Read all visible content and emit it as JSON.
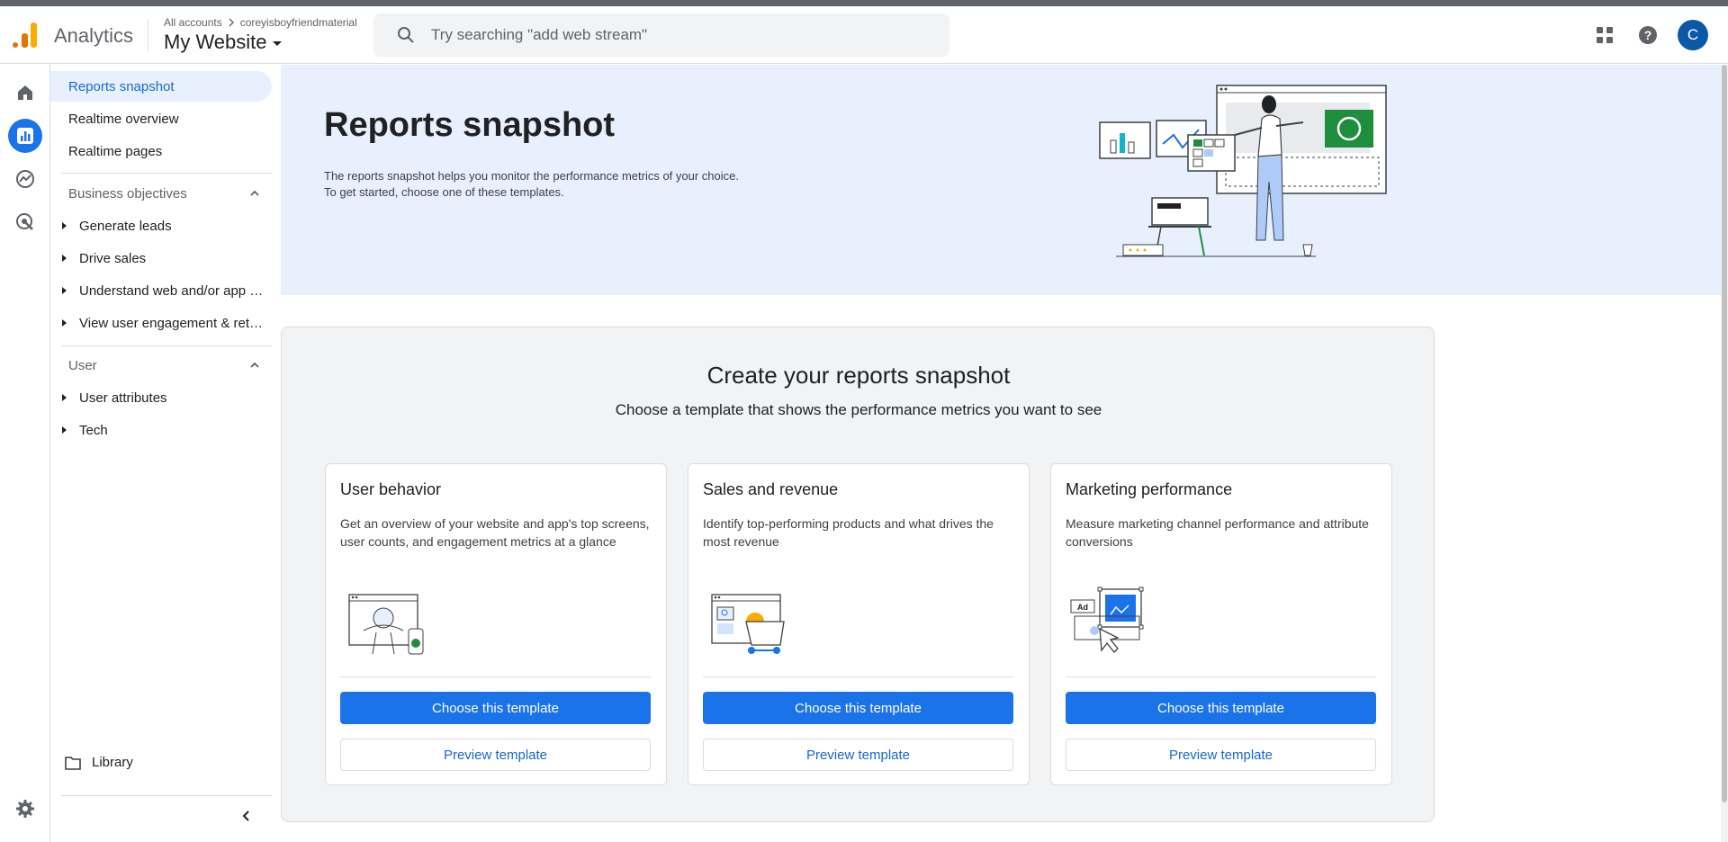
{
  "header": {
    "app_name": "Analytics",
    "breadcrumb_root": "All accounts",
    "breadcrumb_account": "coreyisboyfriendmaterial",
    "property": "My Website",
    "search_placeholder": "Try searching \"add web stream\"",
    "avatar_letter": "C"
  },
  "sidebar": {
    "top_items": [
      {
        "label": "Reports snapshot",
        "active": true
      },
      {
        "label": "Realtime overview"
      },
      {
        "label": "Realtime pages"
      }
    ],
    "groups": [
      {
        "label": "Business objectives",
        "items": [
          "Generate leads",
          "Drive sales",
          "Understand web and/or app traffic",
          "View user engagement & retention"
        ]
      },
      {
        "label": "User",
        "items": [
          "User attributes",
          "Tech"
        ]
      }
    ],
    "library": "Library"
  },
  "hero": {
    "title": "Reports snapshot",
    "desc_line1": "The reports snapshot helps you monitor the performance metrics of your choice.",
    "desc_line2": "To get started, choose one of these templates."
  },
  "panel": {
    "title": "Create your reports snapshot",
    "subtitle": "Choose a template that shows the performance metrics you want to see",
    "cards": [
      {
        "title": "User behavior",
        "desc": "Get an overview of your website and app's top screens, user counts, and engagement metrics at a glance",
        "primary": "Choose this template",
        "secondary": "Preview template"
      },
      {
        "title": "Sales and revenue",
        "desc": "Identify top-performing products and what drives the most revenue",
        "primary": "Choose this template",
        "secondary": "Preview template"
      },
      {
        "title": "Marketing performance",
        "desc": "Measure marketing channel performance and attribute conversions",
        "primary": "Choose this template",
        "secondary": "Preview template"
      }
    ],
    "ad_label": "Ad"
  },
  "colors": {
    "accent": "#1a73e8",
    "hero_bg": "#e8f0fe",
    "panel_bg": "#f1f3f4",
    "logo_orange": "#e37400",
    "logo_yellow": "#f9ab00",
    "avatar": "#0b57a8"
  }
}
